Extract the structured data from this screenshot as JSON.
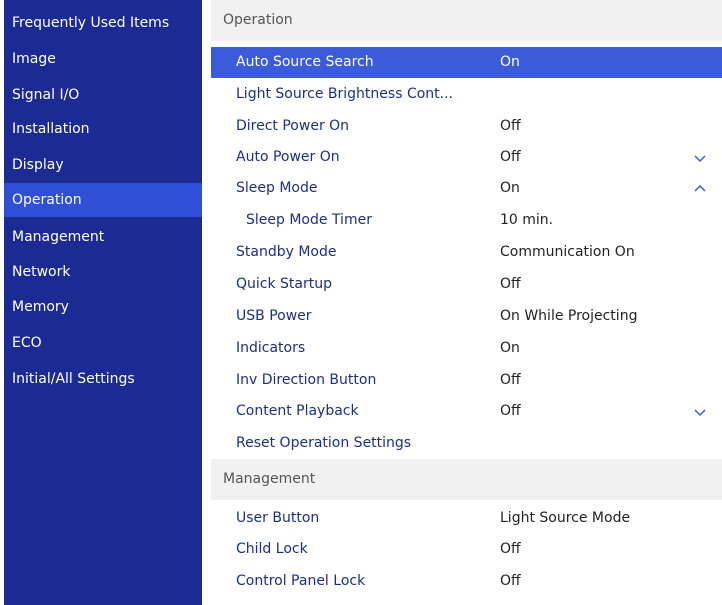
{
  "sidebar": {
    "items": [
      {
        "label": "Frequently Used Items"
      },
      {
        "label": "Image"
      },
      {
        "label": "Signal I/O"
      },
      {
        "label": "Installation"
      },
      {
        "label": "Display"
      },
      {
        "label": "Operation",
        "active": true
      },
      {
        "label": "Management"
      },
      {
        "label": "Network"
      },
      {
        "label": "Memory"
      },
      {
        "label": "ECO"
      },
      {
        "label": "Initial/All Settings"
      }
    ]
  },
  "operation": {
    "header": "Operation",
    "rows": [
      {
        "label": "Auto Source Search",
        "value": "On",
        "selected": true
      },
      {
        "label": "Light Source Brightness Cont...",
        "value": ""
      },
      {
        "label": "Direct Power On",
        "value": "Off"
      },
      {
        "label": "Auto Power On",
        "value": "Off",
        "icon": "chevron-down-icon"
      },
      {
        "label": "Sleep Mode",
        "value": "On",
        "icon": "chevron-up-icon"
      },
      {
        "label": "Sleep Mode Timer",
        "value": "10 min.",
        "indent": true
      },
      {
        "label": "Standby Mode",
        "value": "Communication On"
      },
      {
        "label": "Quick Startup",
        "value": "Off"
      },
      {
        "label": "USB Power",
        "value": "On While Projecting"
      },
      {
        "label": "Indicators",
        "value": "On"
      },
      {
        "label": "Inv Direction Button",
        "value": "Off"
      },
      {
        "label": "Content Playback",
        "value": "Off",
        "icon": "chevron-down-icon"
      },
      {
        "label": "Reset Operation Settings",
        "value": ""
      }
    ]
  },
  "management": {
    "header": "Management",
    "rows": [
      {
        "label": "User Button",
        "value": "Light Source Mode"
      },
      {
        "label": "Child Lock",
        "value": "Off"
      },
      {
        "label": "Control Panel Lock",
        "value": "Off"
      }
    ]
  },
  "colors": {
    "sidebar_bg": "#1c2b93",
    "sidebar_active": "#2e4fd6",
    "row_selected": "#3b5bdb",
    "label_text": "#1a2f86"
  }
}
